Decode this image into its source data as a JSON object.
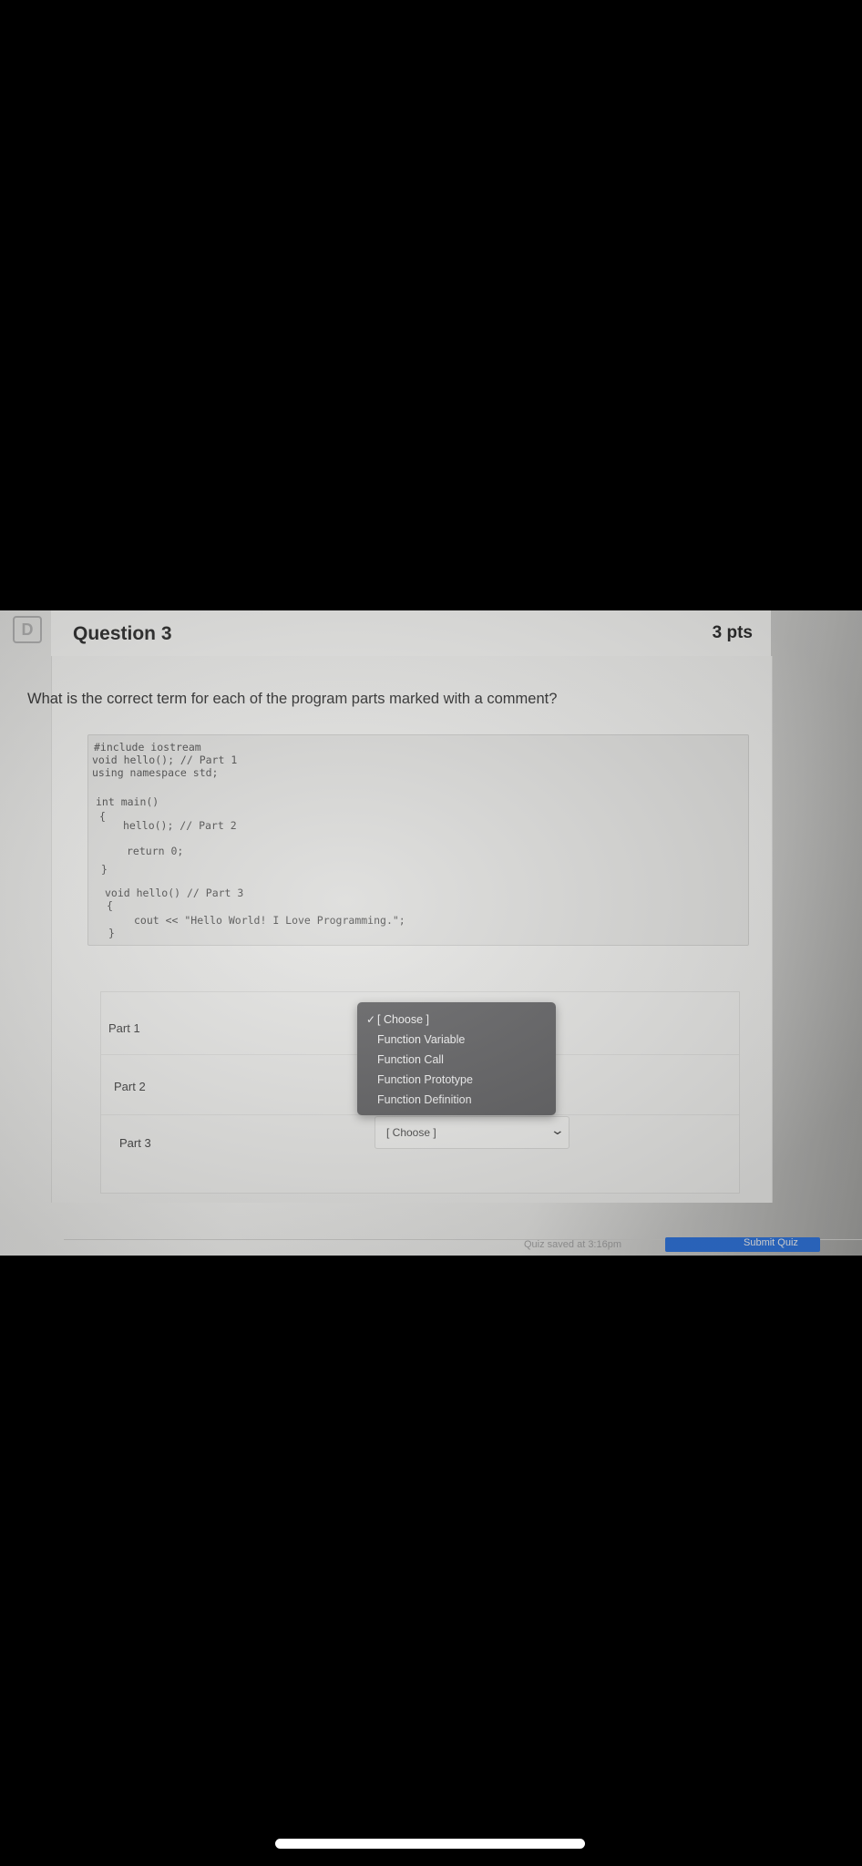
{
  "left_badge": "D",
  "question": {
    "title": "Question 3",
    "points": "3 pts",
    "prompt": "What is the correct term for each of the program parts marked with a comment?"
  },
  "code": {
    "lines": [
      "#include iostream",
      "void hello(); // Part 1",
      "using namespace std;",
      "int main()",
      "{",
      "hello(); // Part 2",
      "return 0;",
      "}",
      "void hello() // Part 3",
      "{",
      "cout << \"Hello World! I Love Programming.\";",
      "}"
    ]
  },
  "answers": {
    "parts": [
      {
        "label": "Part 1"
      },
      {
        "label": "Part 2"
      },
      {
        "label": "Part 3",
        "selected": "[ Choose ]"
      }
    ]
  },
  "dropdown": {
    "checked_item": "[ Choose ]",
    "options": [
      "[ Choose ]",
      "Function Variable",
      "Function Call",
      "Function Prototype",
      "Function Definition"
    ]
  },
  "footer": {
    "status": "Quiz saved at 3:16pm",
    "submit_label": "Submit Quiz"
  },
  "colors": {
    "dropdown_bg": "#5d5d5f",
    "submit_blue": "#2f6fd1"
  }
}
